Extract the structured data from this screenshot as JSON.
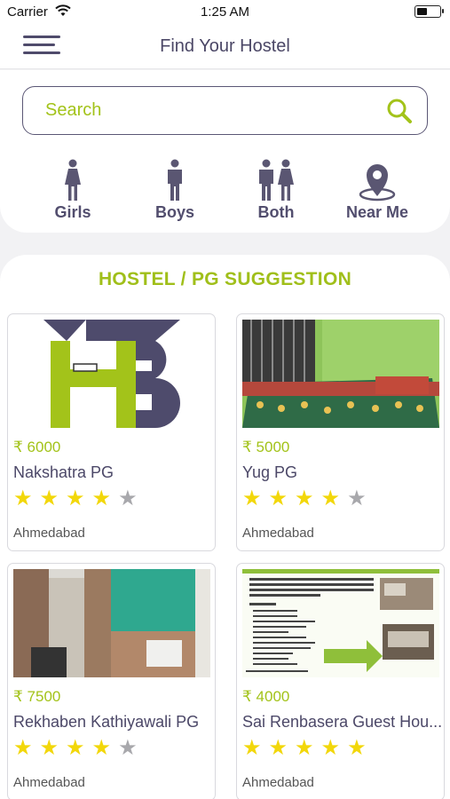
{
  "status_bar": {
    "carrier": "Carrier",
    "time": "1:25 AM"
  },
  "nav": {
    "title": "Find Your Hostel"
  },
  "search": {
    "placeholder": "Search"
  },
  "filters": [
    {
      "label": "Girls",
      "icon": "female-icon"
    },
    {
      "label": "Boys",
      "icon": "male-icon"
    },
    {
      "label": "Both",
      "icon": "couple-icon"
    },
    {
      "label": "Near Me",
      "icon": "location-pin-icon"
    }
  ],
  "suggestions": {
    "title": "HOSTEL / PG SUGGESTION",
    "cards": [
      {
        "price": "₹ 6000",
        "name": "Nakshatra PG",
        "rating": 4,
        "city": "Ahmedabad",
        "image": "hb-logo"
      },
      {
        "price": "₹ 5000",
        "name": "Yug PG",
        "rating": 4,
        "city": "Ahmedabad",
        "image": "room-photo"
      },
      {
        "price": "₹ 7500",
        "name": "Rekhaben Kathiyawali PG",
        "rating": 4,
        "city": "Ahmedabad",
        "image": "building-photo"
      },
      {
        "price": "₹ 4000",
        "name": "Sai Renbasera Guest Hou...",
        "rating": 5,
        "city": "Ahmedabad",
        "image": "facility-flyer"
      }
    ]
  },
  "colors": {
    "accent": "#a3c31a",
    "primary": "#4f4b6b",
    "star": "#f2d70a",
    "star_empty": "#a8a8ac"
  }
}
